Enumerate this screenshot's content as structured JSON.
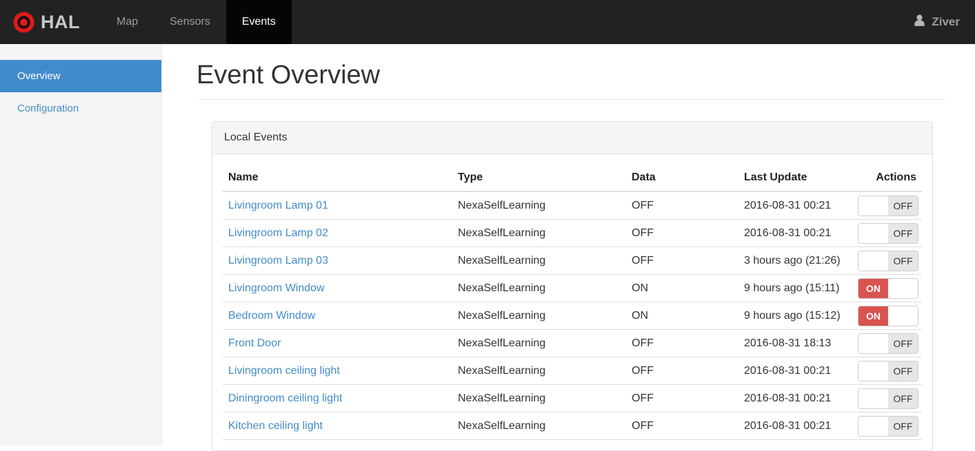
{
  "navbar": {
    "brand": "HAL",
    "brand_icon": "target-icon",
    "items": [
      {
        "label": "Map",
        "active": false
      },
      {
        "label": "Sensors",
        "active": false
      },
      {
        "label": "Events",
        "active": true
      }
    ],
    "user": {
      "icon": "person-icon",
      "name": "Ziver"
    }
  },
  "sidebar": {
    "items": [
      {
        "label": "Overview",
        "active": true
      },
      {
        "label": "Configuration",
        "active": false
      }
    ]
  },
  "main": {
    "title": "Event Overview",
    "panel": {
      "title": "Local Events",
      "table": {
        "columns": [
          "Name",
          "Type",
          "Data",
          "Last Update",
          "Actions"
        ],
        "rows": [
          {
            "name": "Livingroom Lamp 01",
            "type": "NexaSelfLearning",
            "data": "OFF",
            "last_update": "2016-08-31 00:21",
            "switch": "OFF"
          },
          {
            "name": "Livingroom Lamp 02",
            "type": "NexaSelfLearning",
            "data": "OFF",
            "last_update": "2016-08-31 00:21",
            "switch": "OFF"
          },
          {
            "name": "Livingroom Lamp 03",
            "type": "NexaSelfLearning",
            "data": "OFF",
            "last_update": "3 hours ago (21:26)",
            "switch": "OFF"
          },
          {
            "name": "Livingroom Window",
            "type": "NexaSelfLearning",
            "data": "ON",
            "last_update": "9 hours ago (15:11)",
            "switch": "ON"
          },
          {
            "name": "Bedroom Window",
            "type": "NexaSelfLearning",
            "data": "ON",
            "last_update": "9 hours ago (15:12)",
            "switch": "ON"
          },
          {
            "name": "Front Door",
            "type": "NexaSelfLearning",
            "data": "OFF",
            "last_update": "2016-08-31 18:13",
            "switch": "OFF"
          },
          {
            "name": "Livingroom ceiling light",
            "type": "NexaSelfLearning",
            "data": "OFF",
            "last_update": "2016-08-31 00:21",
            "switch": "OFF"
          },
          {
            "name": "Diningroom ceiling light",
            "type": "NexaSelfLearning",
            "data": "OFF",
            "last_update": "2016-08-31 00:21",
            "switch": "OFF"
          },
          {
            "name": "Kitchen ceiling light",
            "type": "NexaSelfLearning",
            "data": "OFF",
            "last_update": "2016-08-31 00:21",
            "switch": "OFF"
          }
        ]
      }
    }
  },
  "colors": {
    "brand_red": "#e01a1a",
    "link_blue": "#428bca",
    "active_blue": "#428bca",
    "switch_on_red": "#d9534f",
    "navbar_bg": "#222222",
    "navbar_active_bg": "#050505",
    "sidebar_bg": "#f5f5f5"
  }
}
